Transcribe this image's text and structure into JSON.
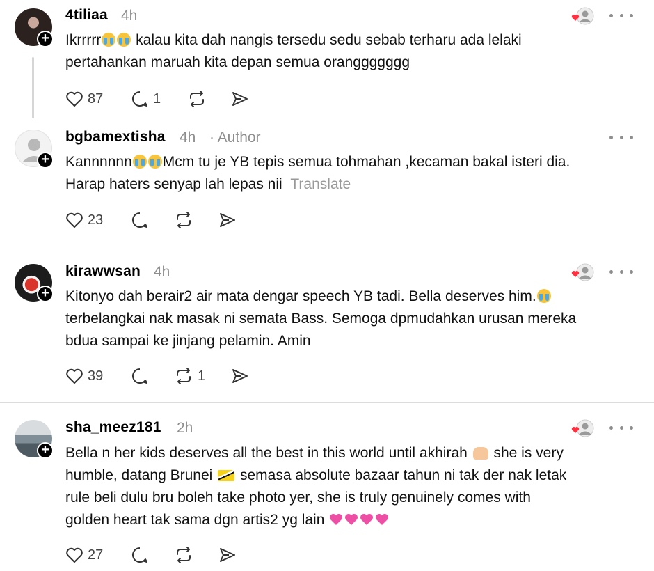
{
  "posts": [
    {
      "username": "4tiliaa",
      "time": "4h",
      "author_tag": "",
      "line1_pre": "Ikrrrrr",
      "line1_post": " kalau kita dah nangis tersedu sedu sebab terharu ada lelaki",
      "line2": "pertahankan maruah kita depan semua oranggggggg",
      "likes": "87",
      "replies": "1",
      "reposts": ""
    },
    {
      "username": "bgbamextisha",
      "time": "4h",
      "author_tag": "· Author",
      "line1_pre": "Kannnnnn",
      "line1_post": "Mcm tu je YB tepis semua tohmahan ,kecaman bakal isteri dia.",
      "line2": "Harap haters senyap lah lepas nii",
      "translate": "Translate",
      "likes": "23",
      "replies": "",
      "reposts": ""
    },
    {
      "username": "kirawwsan",
      "time": "4h",
      "line1_pre": "Kitonyo dah berair2 air mata dengar speech YB tadi. Bella deserves him.",
      "line2": "terbelangkai nak masak ni semata Bass. Semoga dpmudahkan urusan mereka",
      "line3": "bdua sampai ke jinjang pelamin. Amin",
      "likes": "39",
      "replies": "",
      "reposts": "1"
    },
    {
      "username": "sha_meez181",
      "time": "2h",
      "line1_pre": "Bella n her kids deserves all the best in this world until akhirah",
      "line1_post": " she is very",
      "line2_pre": "humble, datang Brunei",
      "line2_post": " semasa absolute bazaar tahun ni tak der nak letak",
      "line3": "rule beli dulu bru boleh take photo yer, she is truly genuinely comes with",
      "line4": "golden heart tak sama dgn artis2 yg lain",
      "likes": "27",
      "replies": "",
      "reposts": ""
    }
  ],
  "icons": {
    "heart": "heart-icon",
    "reply": "reply-icon",
    "repost": "repost-icon",
    "share": "share-icon",
    "more": "more-icon"
  },
  "colors": {
    "liked_heart": "#ff3040",
    "muted": "#8e8e8e",
    "divider": "#dcdcdc"
  }
}
